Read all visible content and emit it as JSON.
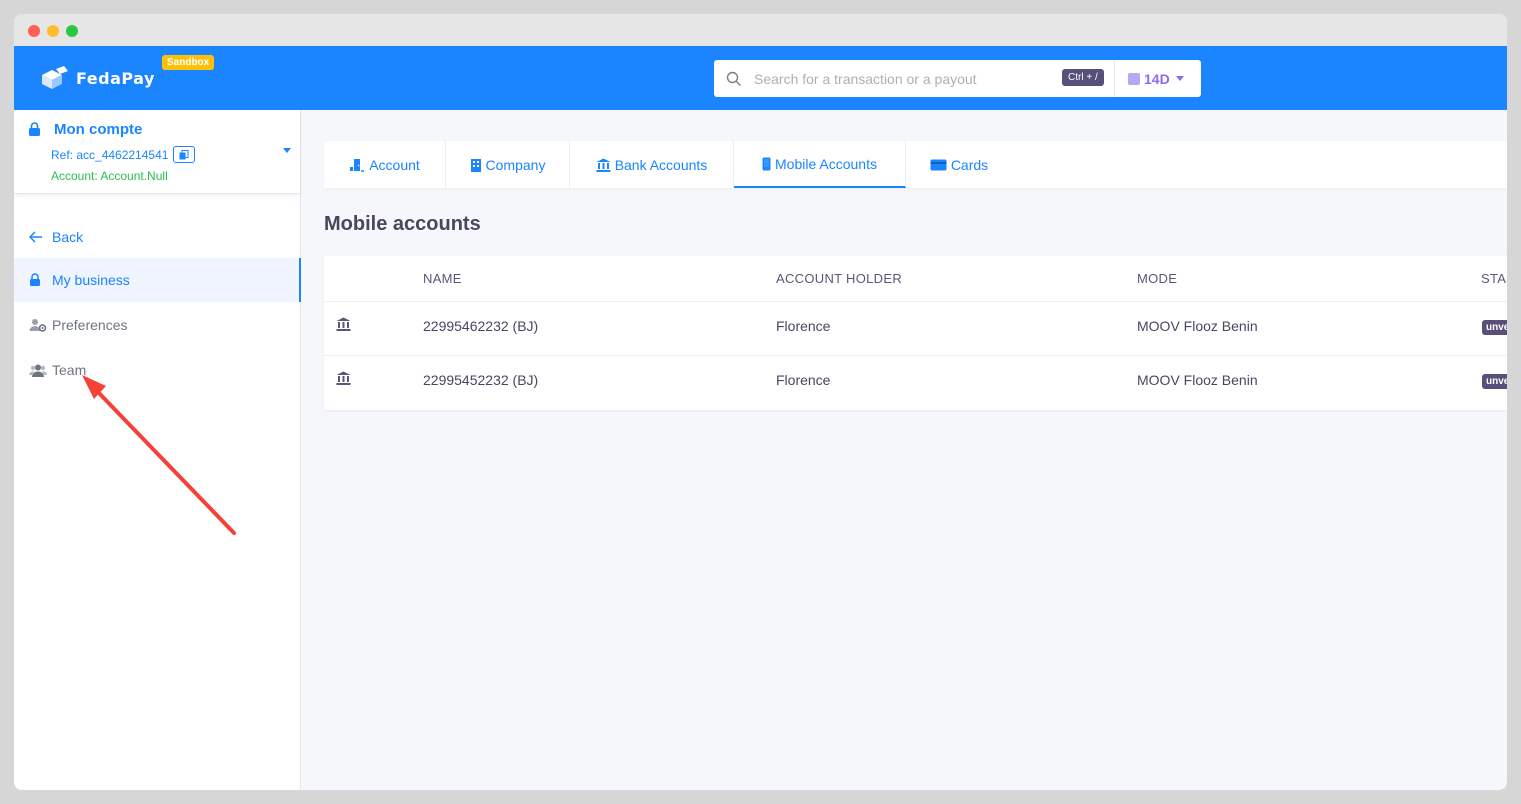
{
  "header": {
    "logo_text": "FedaPay",
    "env_badge": "Sandbox",
    "search_placeholder": "Search for a transaction or a payout",
    "shortcut": "Ctrl + /",
    "period": "14D"
  },
  "account": {
    "title": "Mon compte",
    "ref": "Ref: acc_4462214541",
    "name": "Account: Account.Null"
  },
  "sidebar": {
    "items": [
      {
        "label": "Back"
      },
      {
        "label": "My business"
      },
      {
        "label": "Preferences"
      },
      {
        "label": "Team"
      }
    ]
  },
  "tabs": [
    {
      "label": "Account"
    },
    {
      "label": "Company"
    },
    {
      "label": "Bank Accounts"
    },
    {
      "label": "Mobile Accounts"
    },
    {
      "label": "Cards"
    }
  ],
  "main": {
    "title": "Mobile accounts",
    "columns": [
      "NAME",
      "ACCOUNT HOLDER",
      "MODE",
      "STA"
    ],
    "rows": [
      {
        "name": "22995462232 (BJ)",
        "holder": "Florence",
        "mode": "MOOV Flooz Benin",
        "status": "unve"
      },
      {
        "name": "22995452232 (BJ)",
        "holder": "Florence",
        "mode": "MOOV Flooz Benin",
        "status": "unve"
      }
    ]
  },
  "colors": {
    "brand": "#1a85ff",
    "sandbox": "#ffc107",
    "success": "#2bbd4f",
    "annotation": "#f44336"
  }
}
